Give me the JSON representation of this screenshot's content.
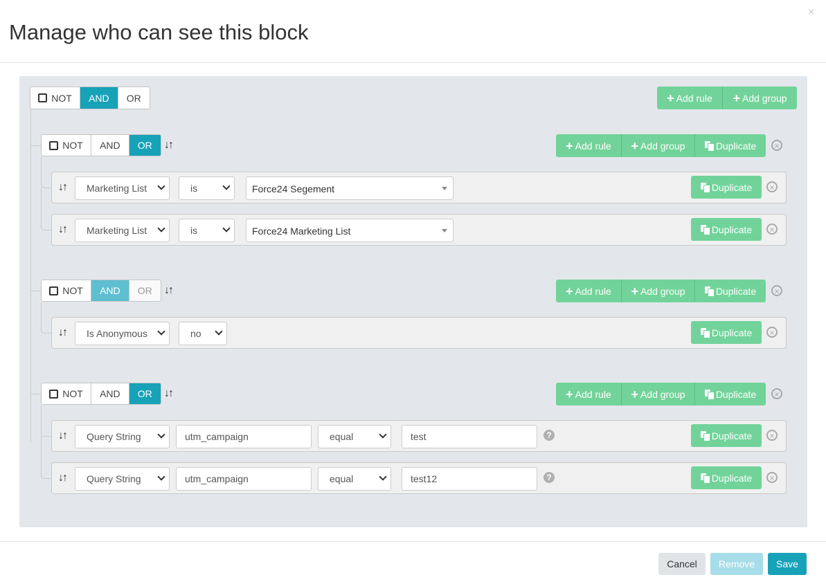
{
  "modal": {
    "title": "Manage who can see this block",
    "close": "×"
  },
  "labels": {
    "not": "NOT",
    "and": "AND",
    "or": "OR",
    "add_rule": "Add rule",
    "add_group": "Add group",
    "duplicate": "Duplicate",
    "sort": "↓↑",
    "plus": "+",
    "remove_x": "×",
    "help": "?"
  },
  "root": {
    "condition": "AND"
  },
  "groups": [
    {
      "condition": "OR",
      "rules": [
        {
          "field": "Marketing List",
          "operator": "is",
          "value": "Force24 Segement"
        },
        {
          "field": "Marketing List",
          "operator": "is",
          "value": "Force24 Marketing List"
        }
      ]
    },
    {
      "condition": "AND",
      "rules": [
        {
          "field": "Is Anonymous",
          "operator": "no"
        }
      ]
    },
    {
      "condition": "OR",
      "rules": [
        {
          "field": "Query String",
          "key": "utm_campaign",
          "operator": "equal",
          "value": "test"
        },
        {
          "field": "Query String",
          "key": "utm_campaign",
          "operator": "equal",
          "value": "test12"
        }
      ]
    }
  ],
  "footer": {
    "cancel": "Cancel",
    "remove": "Remove",
    "save": "Save"
  },
  "colors": {
    "accent": "#17a2b8",
    "green": "#72d39a",
    "panel": "#e3e7eb"
  }
}
